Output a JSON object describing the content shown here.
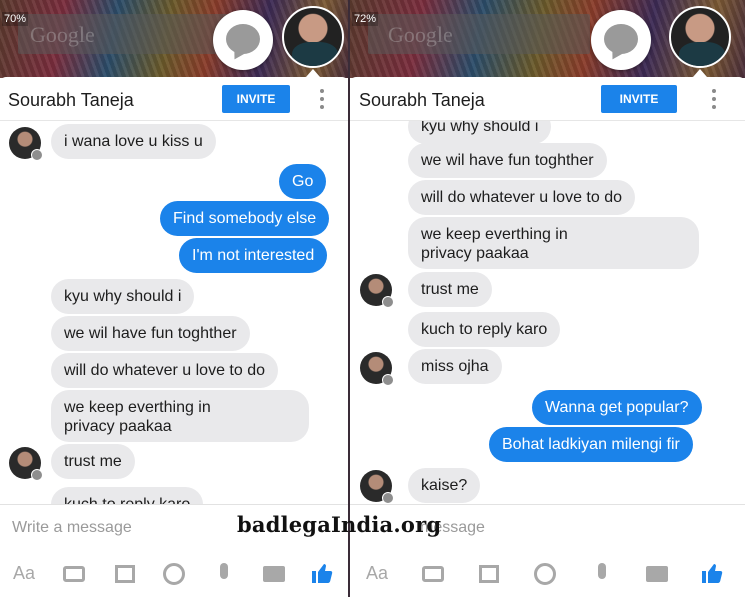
{
  "left": {
    "status": "70%",
    "contact_name": "Sourabh Taneja",
    "invite_label": "INVITE",
    "composer_placeholder": "Write a message",
    "toolbar_text": "Aa",
    "messages": [
      "i wana love u kiss u",
      "Go",
      "Find somebody else",
      "I'm not interested",
      "kyu why should i",
      "we wil have fun toghther",
      "will do whatever u love to do",
      "we keep everthing in",
      "privacy paakaa",
      "trust me",
      "kuch to reply karo"
    ]
  },
  "right": {
    "status": "72%",
    "contact_name": "Sourabh Taneja",
    "invite_label": "INVITE",
    "composer_placeholder": "message",
    "toolbar_text": "Aa",
    "messages": [
      "kyu why should i",
      "we wil have fun toghther",
      "will do whatever u love to do",
      "we keep everthing in",
      "privacy paakaa",
      "trust me",
      "kuch to reply karo",
      "miss ojha",
      "Wanna get popular?",
      "Bohat ladkiyan milengi fir",
      "kaise?"
    ]
  },
  "google_logo": "Google",
  "watermark": "badlegaIndia.org",
  "colors": {
    "accent": "#1b83ea",
    "incoming": "#e9e9eb"
  }
}
